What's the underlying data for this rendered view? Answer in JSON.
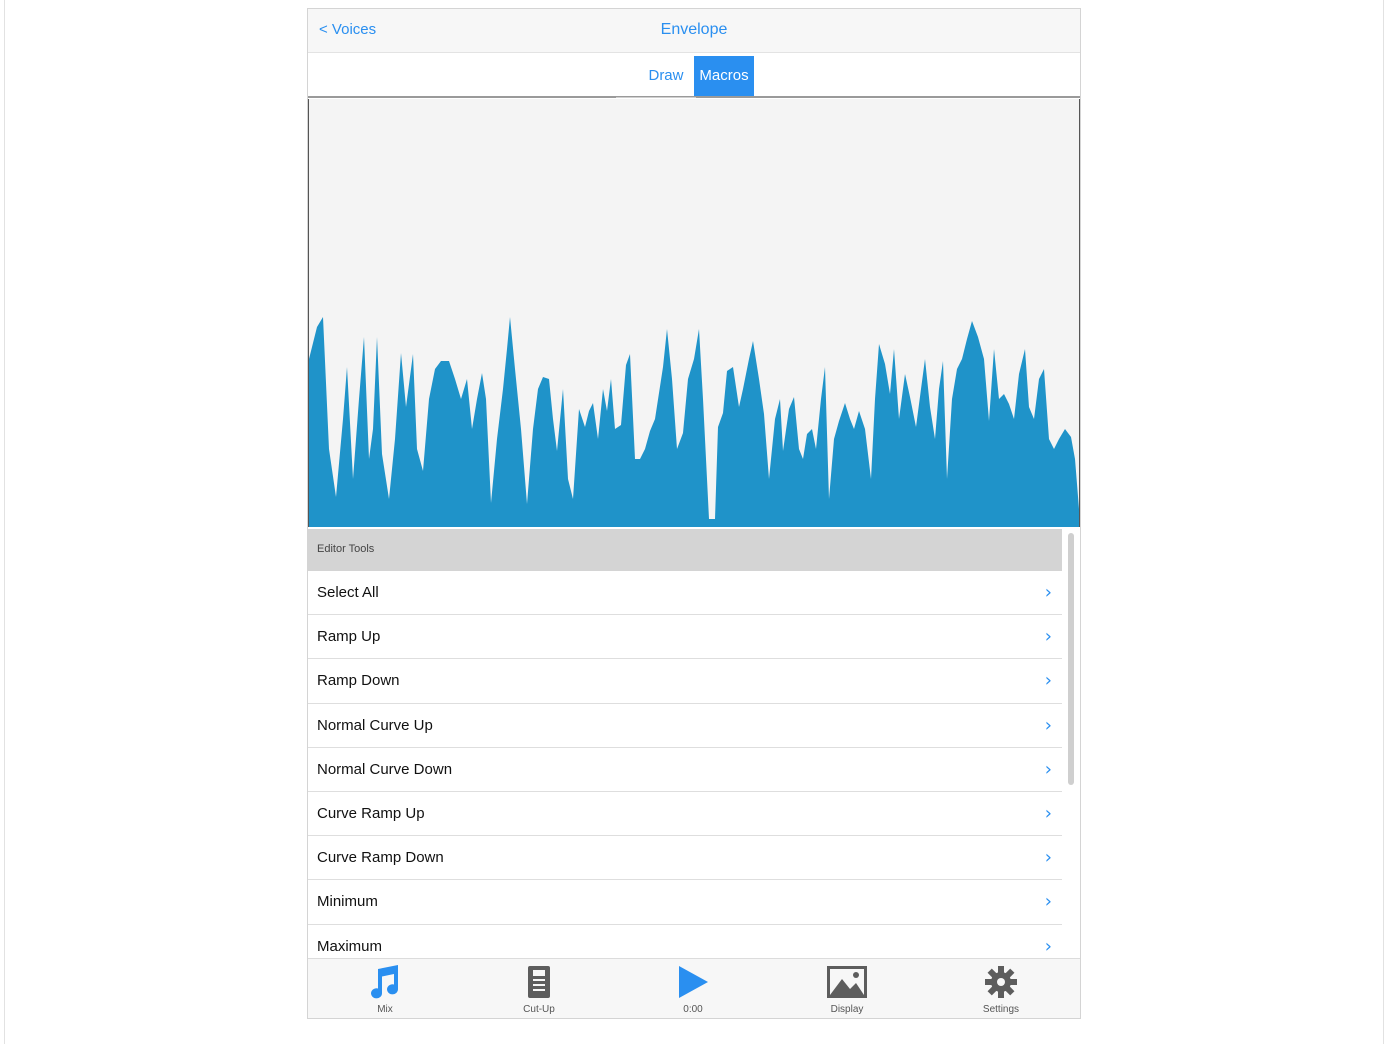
{
  "nav": {
    "back_label": "< Voices",
    "title": "Envelope"
  },
  "segments": {
    "draw": "Draw",
    "macros": "Macros",
    "selected": "Macros"
  },
  "envelope": {
    "fill_color": "#1f93c9",
    "background": "#f4f4f4"
  },
  "editor_tools": {
    "header": "Editor Tools",
    "items": [
      {
        "label": "Select All"
      },
      {
        "label": "Ramp Up"
      },
      {
        "label": "Ramp Down"
      },
      {
        "label": "Normal Curve Up"
      },
      {
        "label": "Normal Curve Down"
      },
      {
        "label": "Curve Ramp Up"
      },
      {
        "label": "Curve Ramp Down"
      },
      {
        "label": "Minimum"
      },
      {
        "label": "Maximum"
      }
    ]
  },
  "tabbar": {
    "tabs": [
      {
        "label": "Mix",
        "icon": "music-note-icon",
        "active": true
      },
      {
        "label": "Cut-Up",
        "icon": "document-icon",
        "active": false
      },
      {
        "label": "0:00",
        "icon": "play-icon",
        "active": false
      },
      {
        "label": "Display",
        "icon": "image-icon",
        "active": false
      },
      {
        "label": "Settings",
        "icon": "gear-icon",
        "active": false
      }
    ]
  },
  "colors": {
    "accent": "#2a8ff0",
    "waveform": "#1f93c9"
  }
}
